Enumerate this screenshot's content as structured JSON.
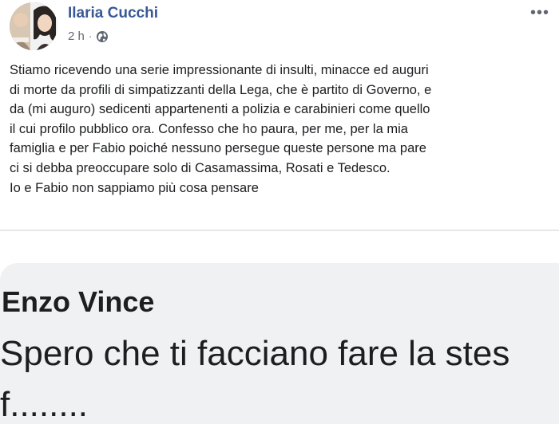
{
  "post": {
    "author": "Ilaria Cucchi",
    "timestamp": "2 h",
    "separator": "·",
    "privacy_icon": "globe-icon",
    "more_icon": "more-options-icon",
    "text_lines": [
      "Stiamo ricevendo una serie impressionante di insulti, minacce ed auguri",
      "di morte da profili di simpatizzanti della Lega, che è partito di Governo, e",
      "da (mi auguro) sedicenti appartenenti a polizia e carabinieri come quello",
      "il cui profilo pubblico ora. Confesso che ho paura, per me, per la mia",
      "famiglia e per Fabio poiché nessuno persegue queste persone ma pare",
      "ci si debba preoccupare solo di Casamassima, Rosati e Tedesco.",
      "Io e Fabio non sappiamo più cosa pensare"
    ]
  },
  "comment": {
    "author": "Enzo Vince",
    "text_lines": [
      "Spero che ti facciano fare la stes",
      "f........"
    ]
  },
  "colors": {
    "author_link": "#385898",
    "text": "#1c1e21",
    "meta": "#616770",
    "comment_bg": "#f0f1f3"
  }
}
